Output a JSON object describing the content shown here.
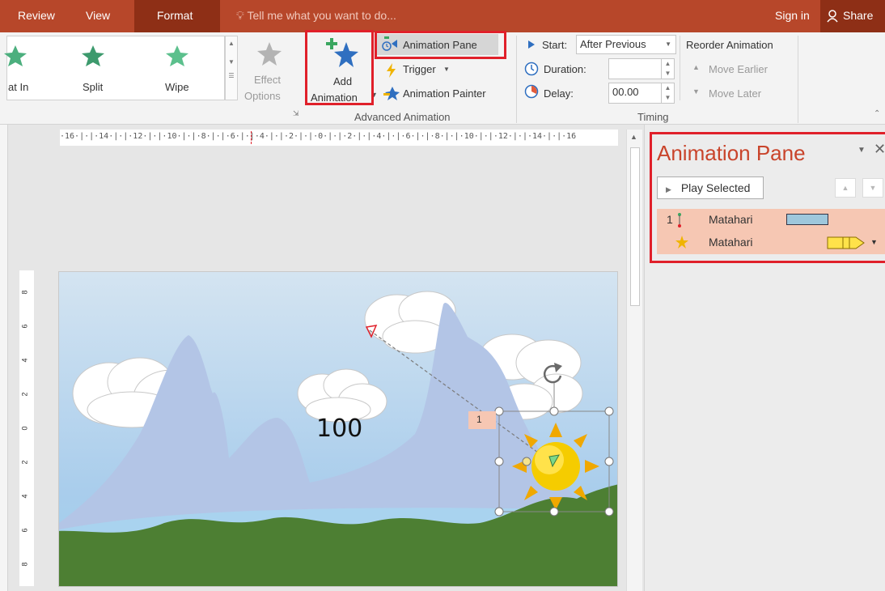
{
  "tabs": {
    "review": "Review",
    "view": "View",
    "format": "Format",
    "tell_me": "Tell me what you want to do...",
    "sign_in": "Sign in",
    "share": "Share"
  },
  "ribbon": {
    "effects": [
      {
        "label": "at In"
      },
      {
        "label": "Split"
      },
      {
        "label": "Wipe"
      }
    ],
    "effect_options": [
      "Effect",
      "Options"
    ],
    "add_animation": [
      "Add",
      "Animation"
    ],
    "animation_pane": "Animation Pane",
    "trigger": "Trigger",
    "animation_painter": "Animation Painter",
    "advanced_group_label": "Advanced Animation",
    "start_label": "Start:",
    "start_value": "After Previous",
    "duration_label": "Duration:",
    "duration_value": "",
    "delay_label": "Delay:",
    "delay_value": "00.00",
    "reorder_label": "Reorder Animation",
    "move_earlier": "Move Earlier",
    "move_later": "Move Later",
    "timing_group_label": "Timing"
  },
  "ruler": {
    "horizontal_text": "·16·|·|·14·|·|·12·|·|·10·|·|·8·|·|·6·|·|·4·|·|·2·|·|·0·|·|·2·|·|·4·|·|·6·|·|·8·|·|·10·|·|·12·|·|·14·|·|·16",
    "vertical_ticks": [
      "8",
      "6",
      "4",
      "2",
      "0",
      "2",
      "4",
      "6",
      "8"
    ]
  },
  "slide": {
    "number_text": "100",
    "animation_tag": "1"
  },
  "pane": {
    "title": "Animation Pane",
    "play_selected": "Play Selected",
    "items": [
      {
        "index": "1",
        "name": "Matahari"
      },
      {
        "index": "",
        "name": "Matahari"
      }
    ]
  },
  "colors": {
    "tab_bar": "#b7472a",
    "tab_active": "#8e2f16",
    "highlight_box": "#e0202a",
    "pane_title": "#c9442b",
    "row_selected": "#f6c7b3"
  }
}
